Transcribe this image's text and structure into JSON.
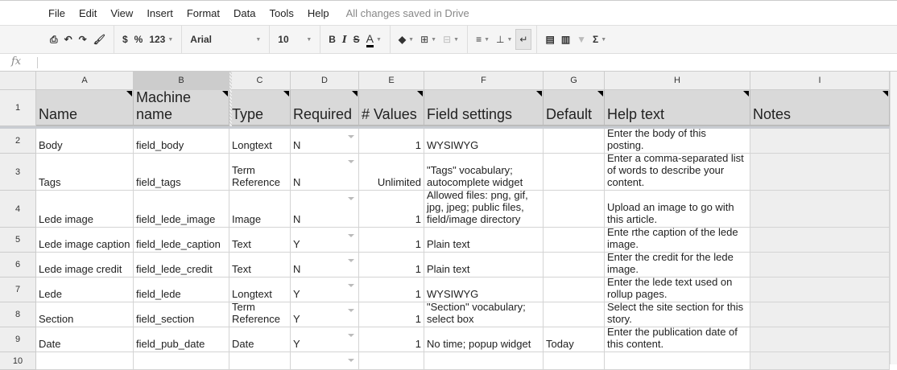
{
  "menu": [
    "File",
    "Edit",
    "View",
    "Insert",
    "Format",
    "Data",
    "Tools",
    "Help"
  ],
  "save_status": "All changes saved in Drive",
  "toolbar": {
    "currency": "$",
    "percent": "%",
    "more_formats": "123",
    "font": "Arial",
    "font_size": "10",
    "bold": "B",
    "italic": "I",
    "strike": "S",
    "text_color": "A",
    "sum": "Σ"
  },
  "formula": {
    "fx": "fx",
    "value": ""
  },
  "columns": [
    "A",
    "B",
    "C",
    "D",
    "E",
    "F",
    "G",
    "H",
    "I"
  ],
  "rows": [
    "1",
    "2",
    "3",
    "4",
    "5",
    "6",
    "7",
    "8",
    "9",
    "10"
  ],
  "headers": [
    "Name",
    "Machine\nname",
    "Type",
    "Required",
    "# Values",
    "Field settings",
    "Default",
    "Help text",
    "Notes"
  ],
  "data": [
    [
      "Body",
      "field_body",
      "Longtext",
      "N",
      "1",
      "WYSIWYG",
      "",
      "Enter the body of this\nposting.",
      ""
    ],
    [
      "Tags",
      "field_tags",
      "Term\nReference",
      "N",
      "Unlimited",
      "\"Tags\" vocabulary;\nautocomplete widget",
      "",
      "Enter a comma-separated list\nof words to describe your\ncontent.",
      ""
    ],
    [
      "Lede image",
      "field_lede_image",
      "Image",
      "N",
      "1",
      "Allowed files: png, gif,\njpg, jpeg; public files,\nfield/image directory",
      "",
      "Upload an image to go with\nthis article.",
      ""
    ],
    [
      "Lede image caption",
      "field_lede_caption",
      "Text",
      "Y",
      "1",
      "Plain text",
      "",
      "Ente rthe caption of the lede\nimage.",
      ""
    ],
    [
      "Lede image credit",
      "field_lede_credit",
      "Text",
      "N",
      "1",
      "Plain text",
      "",
      "Enter the credit for the lede\nimage.",
      ""
    ],
    [
      "Lede",
      "field_lede",
      "Longtext",
      "Y",
      "1",
      "WYSIWYG",
      "",
      "Enter the lede text used on\nrollup pages.",
      ""
    ],
    [
      "Section",
      "field_section",
      "Term\nReference",
      "Y",
      "1",
      "\"Section\" vocabulary;\nselect box",
      "",
      "Select the site section for this\nstory.",
      ""
    ],
    [
      "Date",
      "field_pub_date",
      "Date",
      "Y",
      "1",
      "No time; popup widget",
      "Today",
      "Enter the publication date of\nthis content.",
      ""
    ],
    [
      "",
      "",
      "",
      "",
      "",
      "",
      "",
      "",
      ""
    ]
  ]
}
